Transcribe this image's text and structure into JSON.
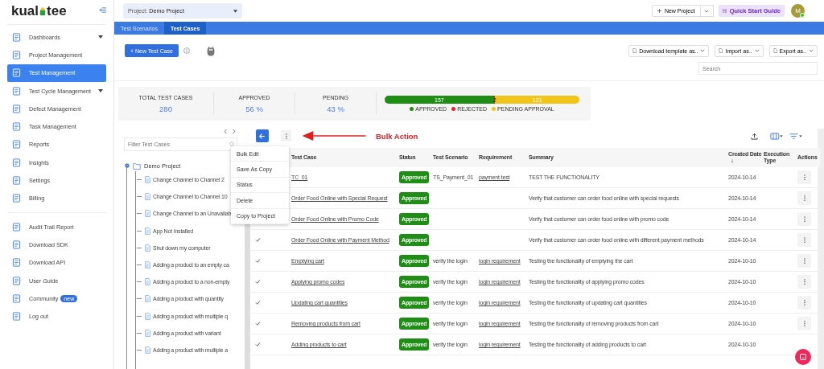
{
  "sidebar": {
    "logo": [
      "kual",
      "tee"
    ],
    "groups": [
      [
        {
          "label": "Dashboards",
          "selected": false,
          "expandable": true
        },
        {
          "label": "Project Management",
          "selected": false,
          "expandable": false
        },
        {
          "label": "Test Management",
          "selected": true,
          "expandable": false
        },
        {
          "label": "Test Cycle Management",
          "selected": false,
          "expandable": true
        },
        {
          "label": "Defect Management",
          "selected": false,
          "expandable": false
        },
        {
          "label": "Task Management",
          "selected": false,
          "expandable": false
        },
        {
          "label": "Reports",
          "selected": false,
          "expandable": false
        },
        {
          "label": "Insights",
          "selected": false,
          "expandable": false
        },
        {
          "label": "Settings",
          "selected": false,
          "expandable": false
        },
        {
          "label": "Billing",
          "selected": false,
          "expandable": false
        }
      ],
      [
        {
          "label": "Audit Trail Report",
          "selected": false,
          "expandable": false
        },
        {
          "label": "Download SDK",
          "selected": false,
          "expandable": false
        },
        {
          "label": "Download API",
          "selected": false,
          "expandable": false
        },
        {
          "label": "User Guide",
          "selected": false,
          "expandable": false
        },
        {
          "label": "Community",
          "selected": false,
          "expandable": false,
          "badge": "new"
        },
        {
          "label": "Log out",
          "selected": false,
          "expandable": false
        }
      ]
    ]
  },
  "topbar": {
    "project_label": "Project:",
    "project": "Demo Project",
    "new_project": "New Project",
    "quick_start": "Quick Start Guide",
    "avatar": "M"
  },
  "tabs": [
    {
      "label": "Test Scenarios",
      "selected": false
    },
    {
      "label": "Test Cases",
      "selected": true
    }
  ],
  "new_test_case": "+ New Test Case",
  "file_buttons": [
    "Download template as..",
    "Import as..",
    "Export as.."
  ],
  "search": {
    "placeholder": "Search"
  },
  "stats": [
    {
      "label": "TOTAL TEST CASES",
      "value": "280"
    },
    {
      "label": "APPROVED",
      "value": "56 %"
    },
    {
      "label": "PENDING",
      "value": "43 %"
    }
  ],
  "progress": [
    {
      "label": "157",
      "level": 0.561,
      "color": "#1e8f14"
    },
    {
      "label": "2",
      "level": 0.007,
      "color": "#e8202a"
    },
    {
      "label": "121",
      "level": 0.432,
      "color": "#f0c419"
    }
  ],
  "legend": [
    {
      "label": "APPROVED",
      "color": "#1e8f14"
    },
    {
      "label": "REJECTED",
      "color": "#e8202a"
    },
    {
      "label": "PENDING APPROVAL",
      "color": "#f0c419"
    }
  ],
  "tree": {
    "filter_placeholder": "Filter Test Cases",
    "root": {
      "label": "Demo Project",
      "expanded": true,
      "children": [
        {
          "label": "Change Channel to Channel 2"
        },
        {
          "label": "Change Channel to Channel 10"
        },
        {
          "label": "Change Channel to an Unavailab"
        },
        {
          "label": "App Not Installed"
        },
        {
          "label": "Shut down my computer"
        },
        {
          "label": "Adding a product to an empty ca"
        },
        {
          "label": "Adding a product to a non-empty"
        },
        {
          "label": "Adding a product with quantity"
        },
        {
          "label": "Adding a product with multiple q"
        },
        {
          "label": "Adding a product with variant"
        },
        {
          "label": "Adding a product with multiple a"
        }
      ]
    }
  },
  "bulk_menu": {
    "items": [
      "Bulk Edit",
      "Save As Copy",
      "Status",
      "Delete",
      "Copy to Project"
    ],
    "annotation": "Bulk Action"
  },
  "table": {
    "columns": [
      {
        "label": "Test Case",
        "sorted": false
      },
      {
        "label": "Status",
        "sorted": false
      },
      {
        "label": "Test Scenario",
        "sorted": false
      },
      {
        "label": "Requirement",
        "sorted": false
      },
      {
        "label": "Summary",
        "sorted": false
      },
      {
        "label": "Created Date",
        "sorted": true
      },
      {
        "label": "Execution Type",
        "sorted": false
      },
      {
        "label": "Actions",
        "sorted": false
      }
    ],
    "rows": [
      {
        "test_case": "TC_01",
        "status": "Approved",
        "test_scenario": "TS_Payment_01",
        "requirement": "payment test",
        "summary": "TEST THE FUNCTIONALITY",
        "created_date": "2024-10-14"
      },
      {
        "test_case": "Order Food Online with Special Request",
        "status": "Approved",
        "summary": "Verify that customer can order food online with special requests",
        "created_date": "2024-10-14"
      },
      {
        "test_case": "Order Food Online with Promo Code",
        "status": "Approved",
        "summary": "Verify that customer can order food online with promo code",
        "created_date": "2024-10-14"
      },
      {
        "checked": true,
        "test_case": "Order Food Online with Payment Method",
        "status": "Approved",
        "summary": "Verify that customer can order food online with different payment methods",
        "created_date": "2024-10-14"
      },
      {
        "checked": true,
        "test_case": "Emptying cart",
        "status": "Approved",
        "test_scenario": "verify the login",
        "requirement": "login requirement",
        "summary": "Testing the functionality of emptying the cart",
        "created_date": "2024-10-10"
      },
      {
        "checked": true,
        "test_case": "Applying promo codes",
        "status": "Approved",
        "test_scenario": "verify the login",
        "requirement": "login requirement",
        "summary": "Testing the functionality of applying promo codes",
        "created_date": "2024-10-10"
      },
      {
        "checked": true,
        "test_case": "Updating cart quantities",
        "status": "Approved",
        "test_scenario": "verify the login",
        "requirement": "login requirement",
        "summary": "Testing the functionality of updating cart quantities",
        "created_date": "2024-10-10"
      },
      {
        "checked": true,
        "test_case": "Removing products from cart",
        "status": "Approved",
        "test_scenario": "verify the login",
        "requirement": "login requirement",
        "summary": "Testing the functionality of removing products from cart",
        "created_date": "2024-10-10"
      },
      {
        "checked": true,
        "test_case": "Adding products to cart",
        "status": "Approved",
        "test_scenario": "verify the login",
        "requirement": "login requirement",
        "summary": "Testing the functionality of adding products to cart",
        "created_date": "2024-10-10"
      }
    ]
  }
}
